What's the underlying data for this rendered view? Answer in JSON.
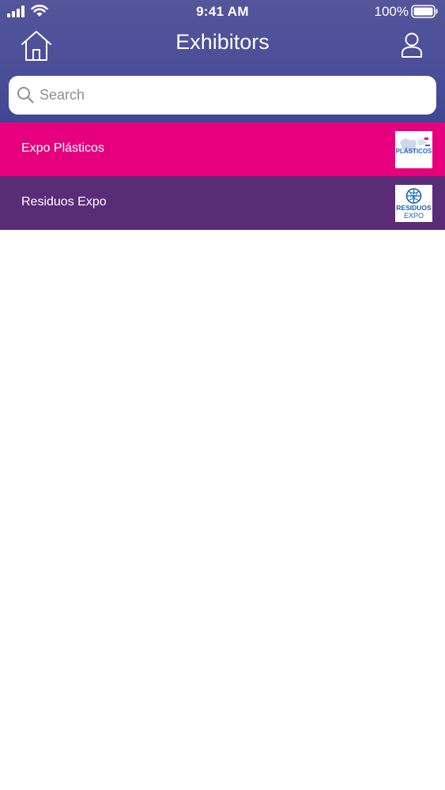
{
  "status_bar": {
    "time": "9:41 AM",
    "battery_percent": "100%",
    "icons": [
      "signal-icon",
      "wifi-icon",
      "battery-icon"
    ]
  },
  "navbar": {
    "title": "Exhibitors",
    "left_icon": "home-icon",
    "right_icon": "user-icon"
  },
  "search": {
    "placeholder": "Search",
    "value": ""
  },
  "exhibitors": [
    {
      "label": "Expo Plásticos",
      "color": "#e6007e",
      "logo": "expo-plasticos-logo",
      "logo_text": "PLÁSTICOS"
    },
    {
      "label": "Residuos Expo",
      "color": "#5a2c78",
      "logo": "residuos-expo-logo",
      "logo_text_1": "RESIDUOS",
      "logo_text_2": "EXPO"
    }
  ],
  "colors": {
    "header": "#4a4e98",
    "row_primary": "#e6007e",
    "row_secondary": "#5a2c78"
  }
}
